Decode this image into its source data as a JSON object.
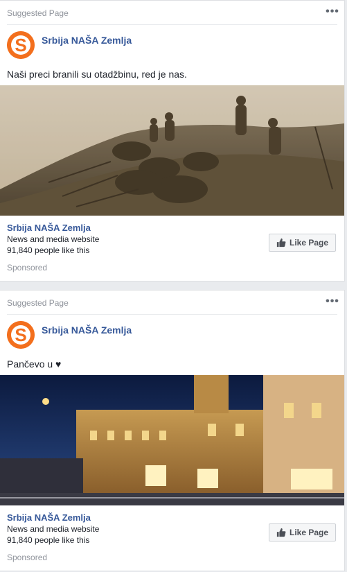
{
  "posts": [
    {
      "suggested_label": "Suggested Page",
      "more_icon": "more-horizontal-icon",
      "page_name": "Srbija NAŠA Zemlja",
      "text": "Naši preci branili su otadžbinu, red je nas.",
      "footer": {
        "page_name": "Srbija NAŠA Zemlja",
        "category": "News and media website",
        "likes": "91,840 people like this",
        "like_button": "Like Page",
        "sponsored": "Sponsored"
      }
    },
    {
      "suggested_label": "Suggested Page",
      "more_icon": "more-horizontal-icon",
      "page_name": "Srbija NAŠA Zemlja",
      "text": "Pančevo u ♥",
      "footer": {
        "page_name": "Srbija NAŠA Zemlja",
        "category": "News and media website",
        "likes": "91,840 people like this",
        "like_button": "Like Page",
        "sponsored": "Sponsored"
      }
    }
  ],
  "colors": {
    "link_blue": "#365899",
    "logo_orange": "#f36f1d",
    "meta_gray": "#90949c",
    "background": "#e9ebee"
  }
}
